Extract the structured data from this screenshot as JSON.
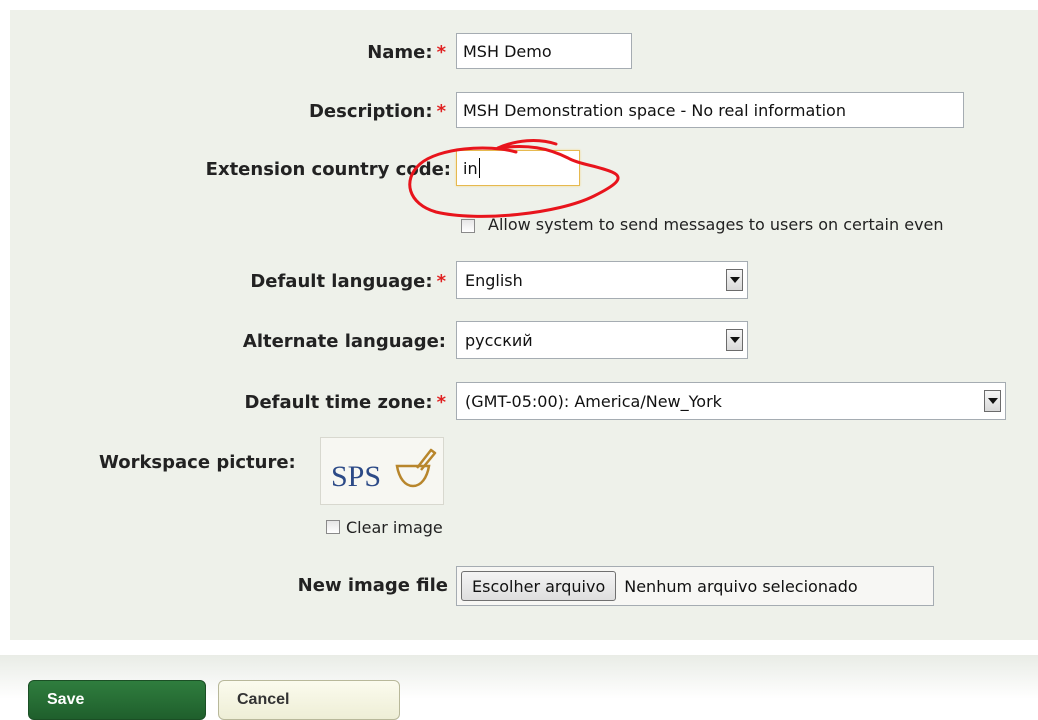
{
  "form": {
    "name": {
      "label": "Name:",
      "required": "*",
      "value": "MSH Demo"
    },
    "description": {
      "label": "Description:",
      "required": "*",
      "value": "MSH Demonstration space - No real information"
    },
    "extension_country_code": {
      "label": "Extension country code:",
      "value": "in"
    },
    "send_messages": {
      "label": "Allow system to send messages to users on certain even",
      "checked": false
    },
    "default_language": {
      "label": "Default language:",
      "required": "*",
      "selected": "English"
    },
    "alternate_language": {
      "label": "Alternate language:",
      "selected": "русский"
    },
    "default_time_zone": {
      "label": "Default time zone:",
      "required": "*",
      "selected": "(GMT-05:00): America/New_York"
    },
    "workspace_picture": {
      "label": "Workspace picture:",
      "logo_text": "SPS",
      "clear_label": "Clear image",
      "clear_checked": false
    },
    "new_image_file": {
      "label": "New image file",
      "button": "Escolher arquivo",
      "status": "Nenhum arquivo selecionado"
    }
  },
  "actions": {
    "save": "Save",
    "cancel": "Cancel"
  },
  "colors": {
    "required": "#e02222",
    "annotation": "#e8141c",
    "save_bg": "#2f7d3e",
    "panel_bg": "#eef1ea",
    "focus_border": "#e6b94f"
  },
  "icons": {
    "select_arrow": "chevron-down-icon",
    "logo_mark": "mortar-pestle-icon"
  }
}
